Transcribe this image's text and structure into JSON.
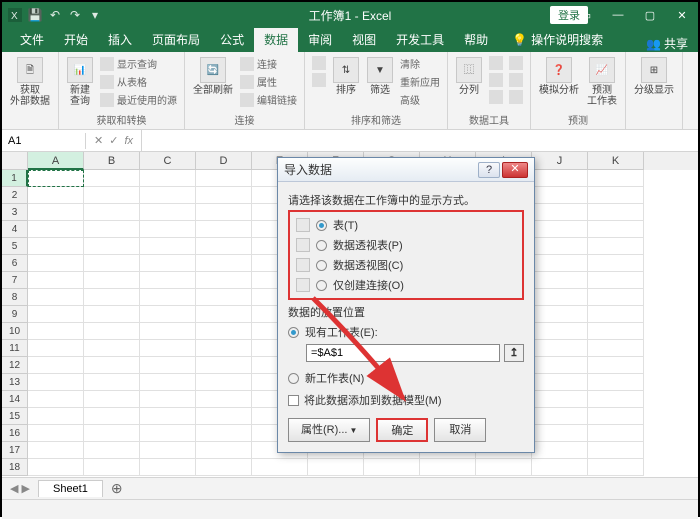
{
  "titlebar": {
    "app_title": "工作簿1 - Excel",
    "login": "登录"
  },
  "win": {
    "min": "—",
    "max": "▢",
    "close": "✕",
    "ribbon_toggle": "▭"
  },
  "tabs": {
    "file": "文件",
    "home": "开始",
    "insert": "插入",
    "page_layout": "页面布局",
    "formulas": "公式",
    "data": "数据",
    "review": "审阅",
    "view": "视图",
    "developer": "开发工具",
    "help": "帮助",
    "tell_me": "操作说明搜索",
    "share": "共享"
  },
  "ribbon": {
    "ext_data": {
      "btn": "获取\n外部数据",
      "group": ""
    },
    "new_query": "新建\n查询",
    "show_queries": "显示查询",
    "from_table": "从表格",
    "recent": "最近使用的源",
    "get_transform": "获取和转换",
    "refresh": "全部刷新",
    "connections": "连接",
    "properties": "属性",
    "edit_links": "编辑链接",
    "conn_group": "连接",
    "sort_asc": "A↓Z",
    "sort_desc": "Z↓A",
    "sort": "排序",
    "filter": "筛选",
    "clear": "清除",
    "reapply": "重新应用",
    "advanced": "高级",
    "sort_filter_group": "排序和筛选",
    "text_cols": "分列",
    "flash_fill": "快速填充",
    "data_tools_group": "数据工具",
    "whatif": "模拟分析",
    "forecast_sheet": "预测\n工作表",
    "forecast_group": "预测",
    "outline": "分级显示"
  },
  "formula_bar": {
    "name_box": "A1",
    "fx": "fx"
  },
  "columns": [
    "A",
    "B",
    "C",
    "D",
    "E",
    "F",
    "G",
    "H",
    "I",
    "J",
    "K"
  ],
  "rows_count": 18,
  "sheet": {
    "tab1": "Sheet1",
    "add": "⊕"
  },
  "dialog": {
    "title": "导入数据",
    "prompt": "请选择该数据在工作簿中的显示方式。",
    "opt_table": "表(T)",
    "opt_pivot_table": "数据透视表(P)",
    "opt_pivot_chart": "数据透视图(C)",
    "opt_conn_only": "仅创建连接(O)",
    "placement_label": "数据的放置位置",
    "existing_ws": "现有工作表(E):",
    "range_value": "=$A$1",
    "new_ws": "新工作表(N)",
    "add_model": "将此数据添加到数据模型(M)",
    "properties_btn": "属性(R)...",
    "ok_btn": "确定",
    "cancel_btn": "取消"
  }
}
